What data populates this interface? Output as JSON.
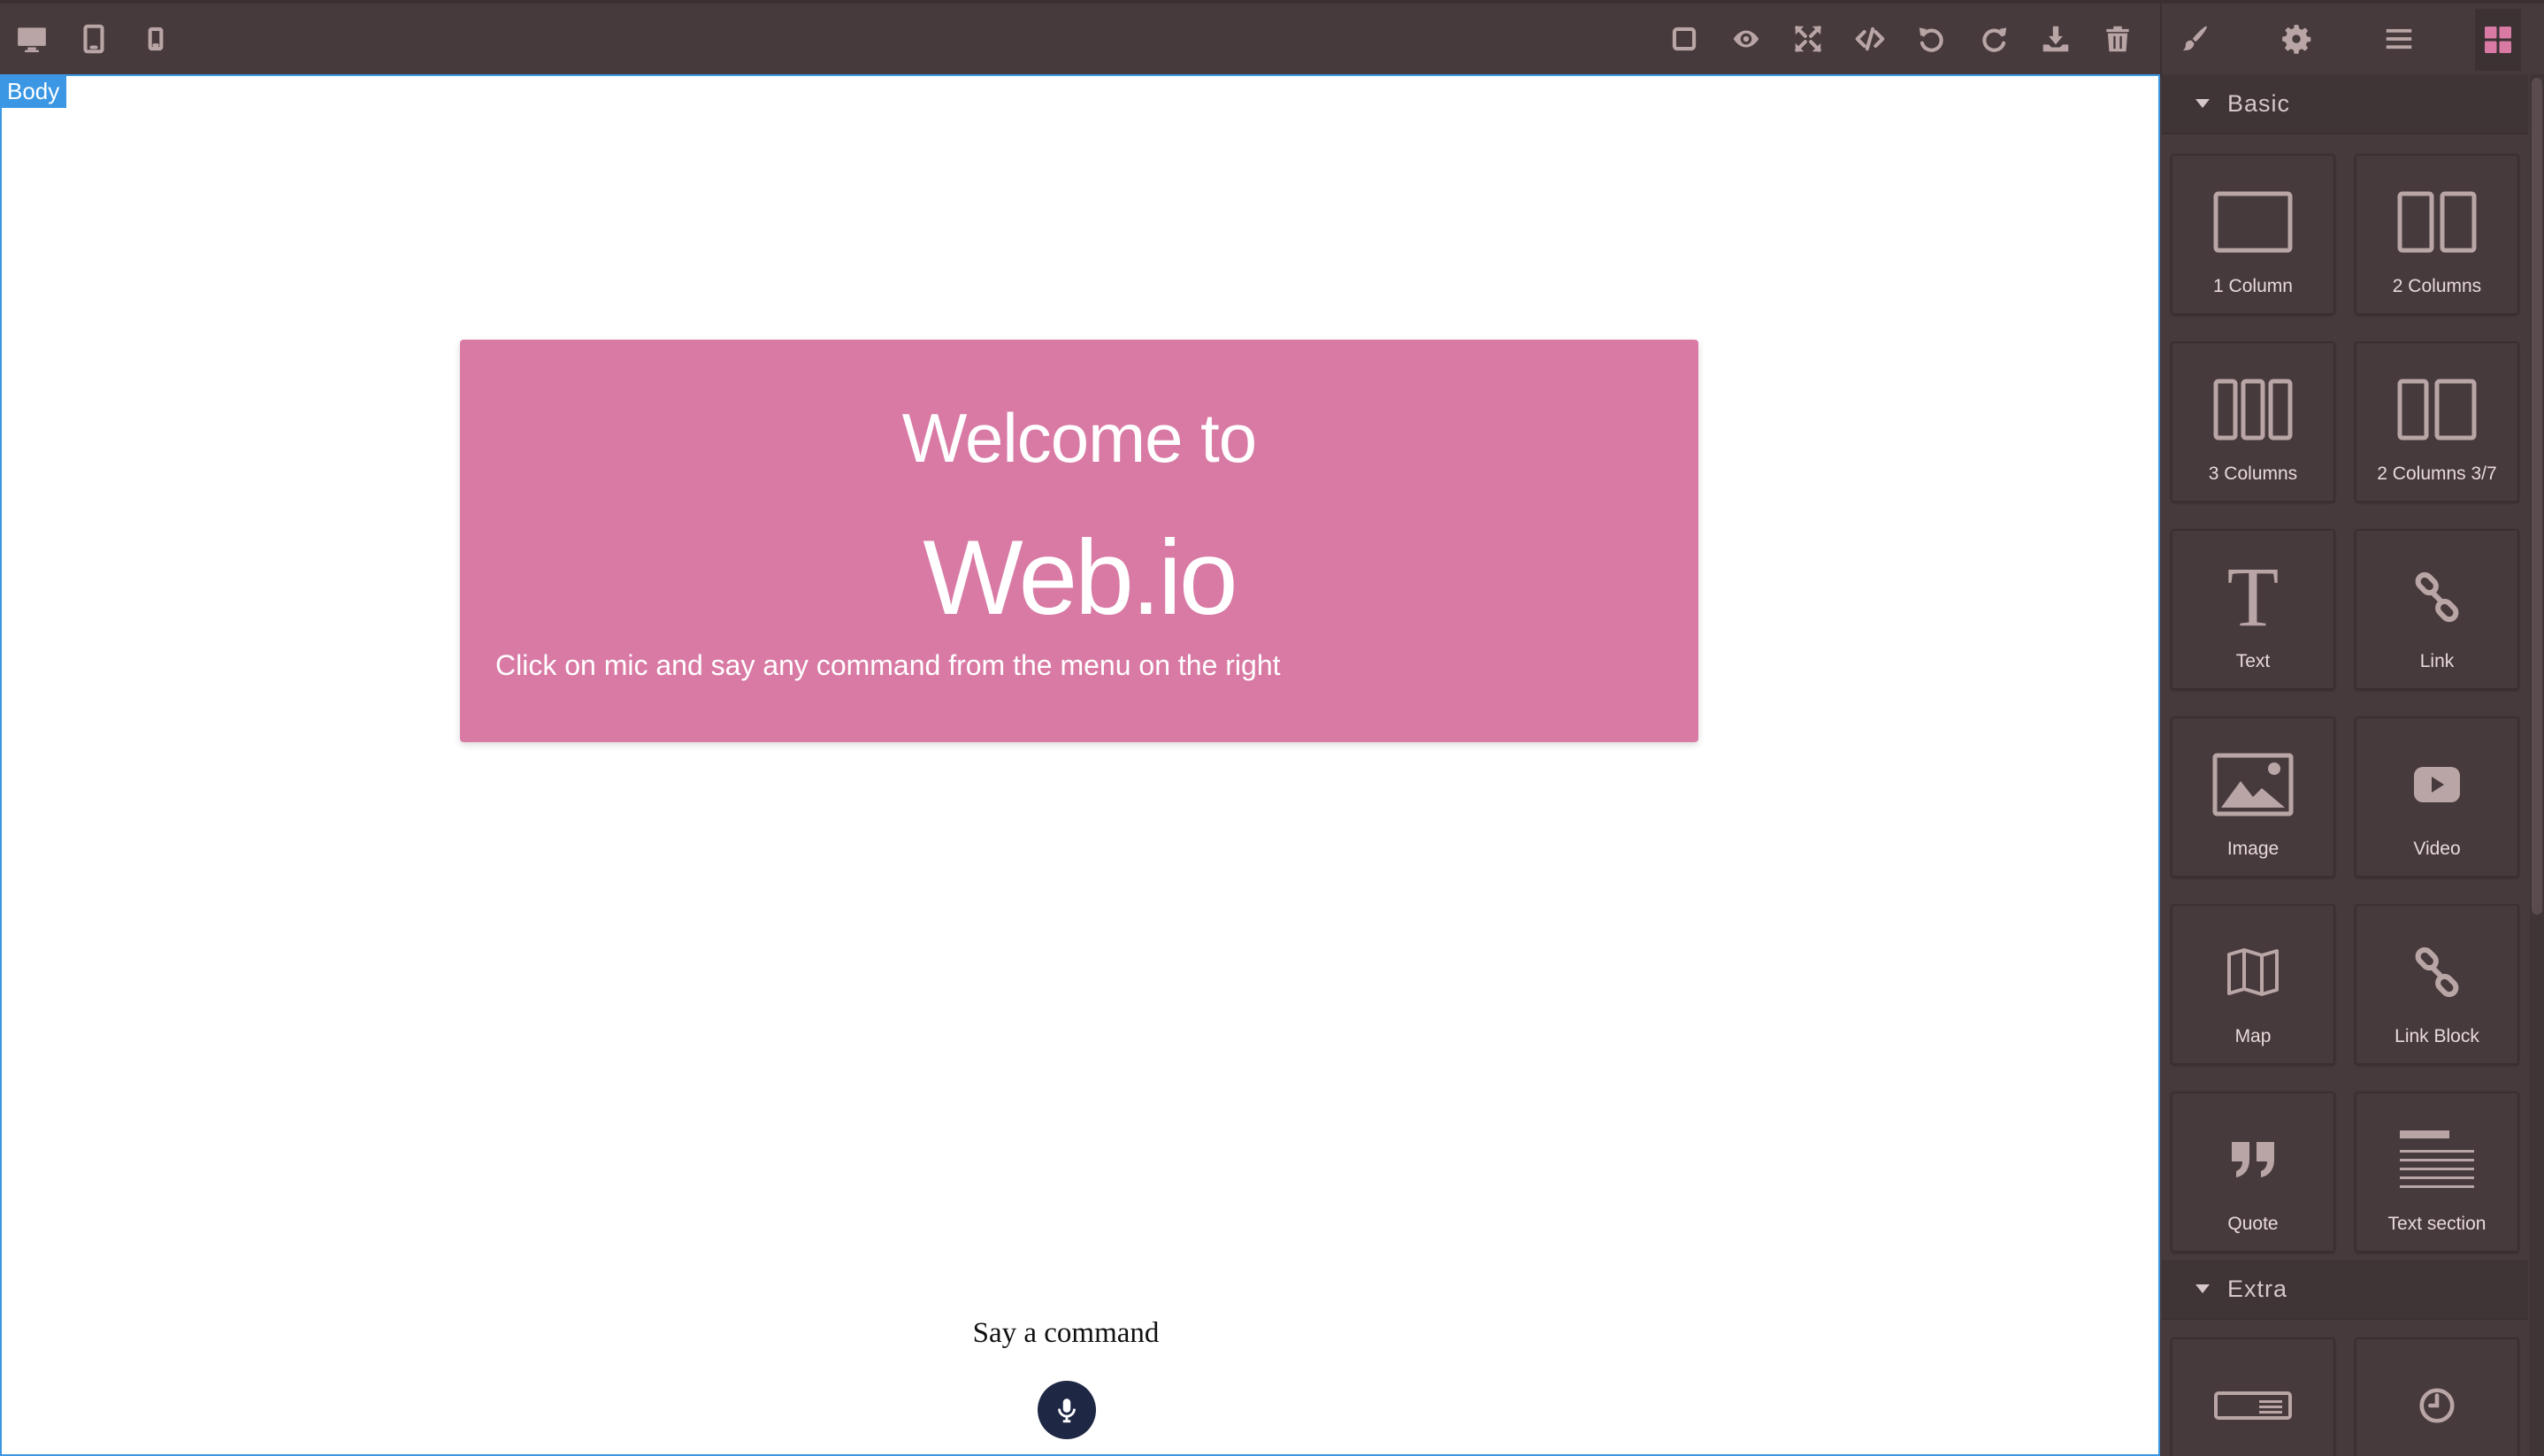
{
  "colors": {
    "toolbar_bg": "#463a3c",
    "panel_bg": "#463a3c",
    "icon": "#b9a5a6",
    "hero_bg": "#d97aa5",
    "selection": "#3b97e3",
    "mic_bg": "#1e2744"
  },
  "toolbar": {
    "devices": [
      "desktop-icon",
      "tablet-icon",
      "mobile-icon"
    ],
    "actions": [
      "sw-visibility-icon",
      "preview-icon",
      "fullscreen-icon",
      "code-icon",
      "undo-icon",
      "redo-icon",
      "import-icon",
      "trash-icon"
    ],
    "panels": [
      "style-manager-icon",
      "settings-icon",
      "layer-manager-icon",
      "blocks-icon"
    ]
  },
  "canvas": {
    "selected_badge": "Body",
    "hero": {
      "line1": "Welcome to",
      "line2": "Web.io",
      "subtitle": "Click on mic and say any command from the menu on the right"
    },
    "command_label": "Say a command",
    "mic_icon": "microphone-icon"
  },
  "blocks_panel": {
    "categories": [
      {
        "title": "Basic",
        "blocks": [
          {
            "label": "1 Column",
            "icon": "one-column-icon"
          },
          {
            "label": "2 Columns",
            "icon": "two-columns-icon"
          },
          {
            "label": "3 Columns",
            "icon": "three-columns-icon"
          },
          {
            "label": "2 Columns 3/7",
            "icon": "two-columns-37-icon"
          },
          {
            "label": "Text",
            "icon": "text-icon"
          },
          {
            "label": "Link",
            "icon": "link-icon"
          },
          {
            "label": "Image",
            "icon": "image-icon"
          },
          {
            "label": "Video",
            "icon": "video-icon"
          },
          {
            "label": "Map",
            "icon": "map-icon"
          },
          {
            "label": "Link Block",
            "icon": "link-block-icon"
          },
          {
            "label": "Quote",
            "icon": "quote-icon"
          },
          {
            "label": "Text section",
            "icon": "text-section-icon"
          }
        ]
      },
      {
        "title": "Extra",
        "blocks": [
          {
            "label": "",
            "icon": "form-input-icon"
          },
          {
            "label": "",
            "icon": "countdown-icon"
          }
        ]
      }
    ]
  }
}
